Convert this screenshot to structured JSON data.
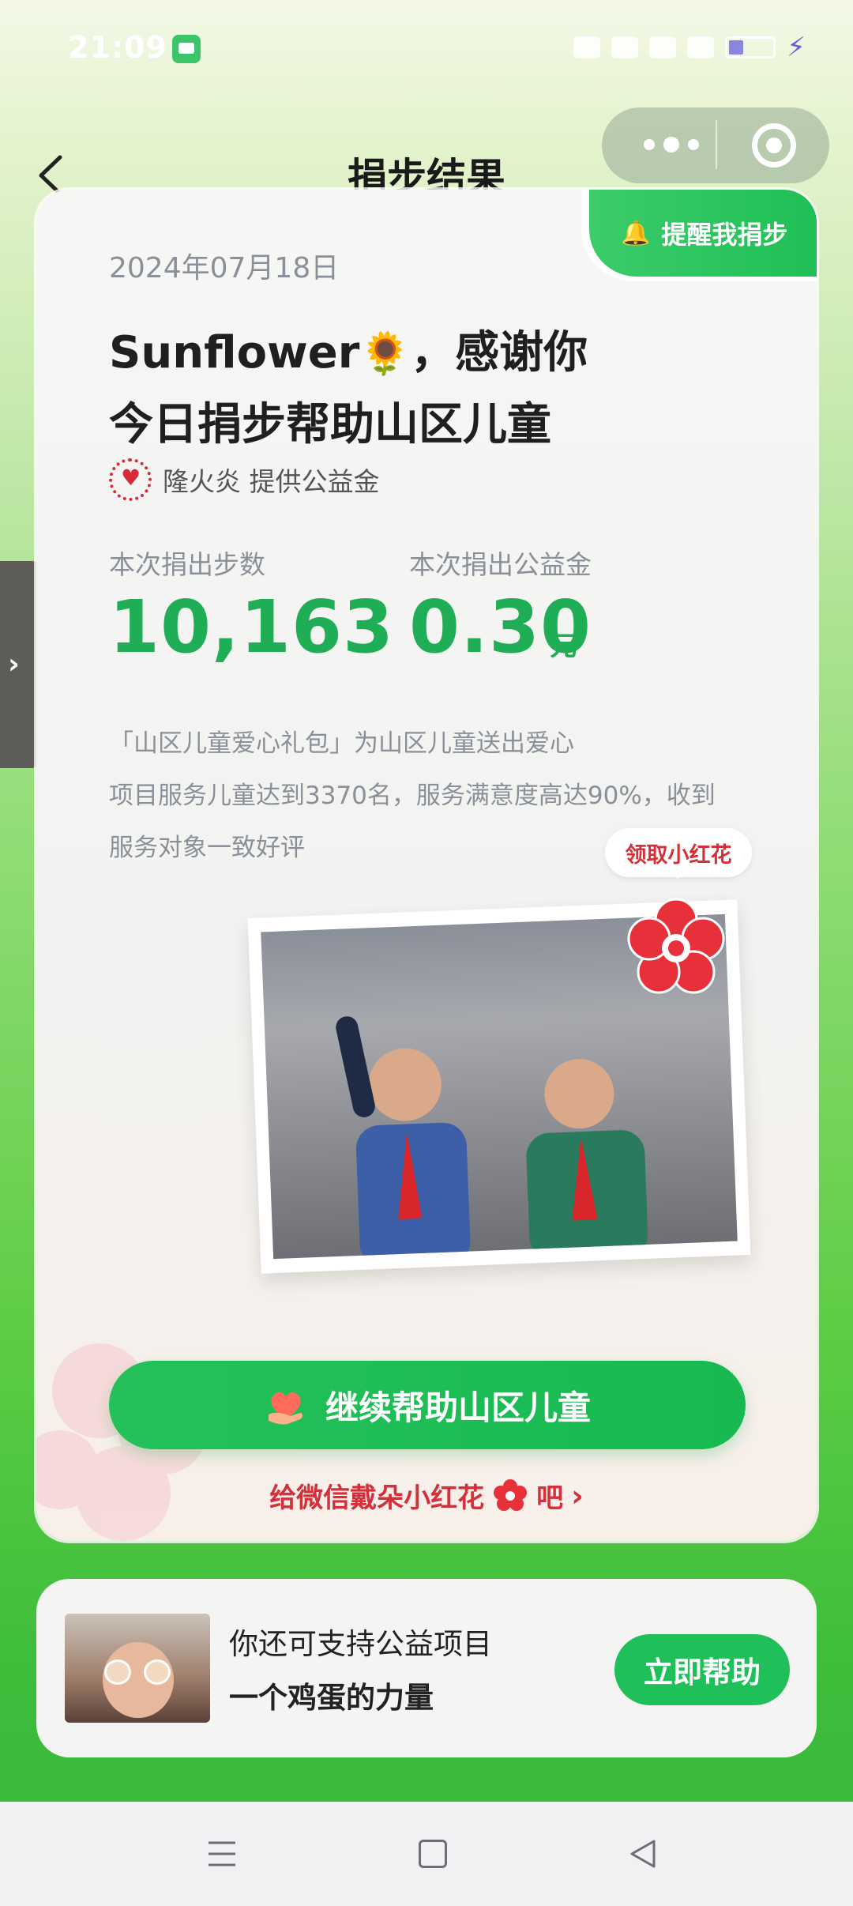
{
  "status_bar": {
    "time": "21:09"
  },
  "nav": {
    "title": "捐步结果"
  },
  "card": {
    "remind_label": "提醒我捐步",
    "date": "2024年07月18日",
    "headline_name": "Sunflower",
    "headline_emoji": "🌻",
    "headline_line1_suffix": "，感谢你",
    "headline_line2": "今日捐步帮助山区儿童",
    "sponsor_text": "隆火炎 提供公益金",
    "steps_label": "本次捐出步数",
    "steps_value": "10,163",
    "fund_label": "本次捐出公益金",
    "fund_value": "0.30",
    "fund_unit": "元",
    "desc_line1": "「山区儿童爱心礼包」为山区儿童送出爱心",
    "desc_line2": "项目服务儿童达到3370名，服务满意度高达90%，收到",
    "desc_line3": "服务对象一致好评",
    "claim_label": "领取小红花",
    "cta_label": "继续帮助山区儿童",
    "link_text_before": "给微信戴朵小红花",
    "link_text_after": "吧"
  },
  "bottom_card": {
    "line1": "你还可支持公益项目",
    "line2": "一个鸡蛋的力量",
    "button": "立即帮助"
  },
  "colors": {
    "accent": "#1fae55",
    "red": "#d4303a"
  }
}
